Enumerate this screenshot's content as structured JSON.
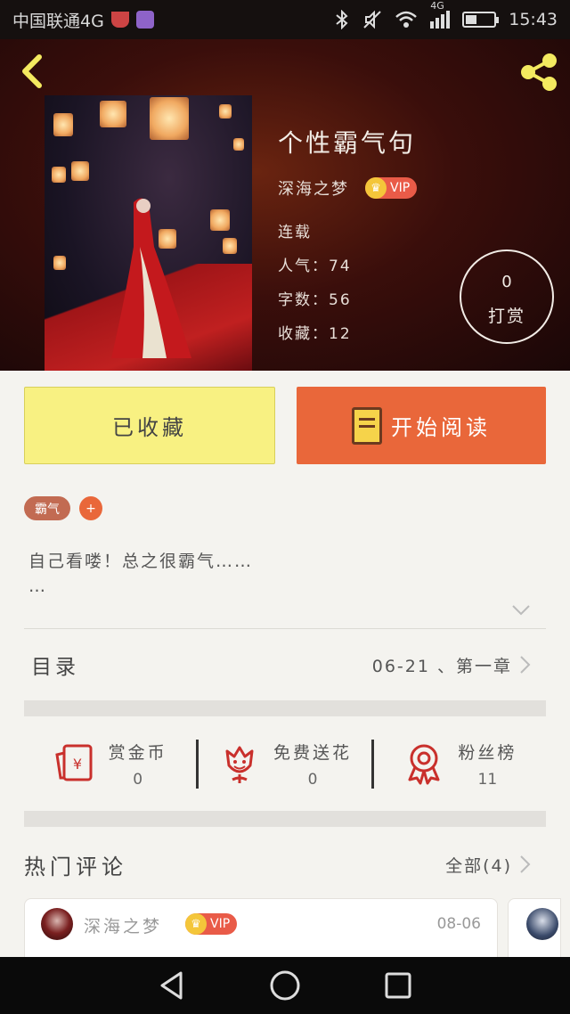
{
  "status_bar": {
    "carrier": "中国联通4G",
    "network": "4G",
    "time": "15:43"
  },
  "book": {
    "title": "个性霸气句",
    "author": "深海之梦",
    "vip_label": "VIP",
    "status": "连载",
    "popularity": "人气：74",
    "word_count": "字数：56",
    "favorites": "收藏：12",
    "reward_count": "0",
    "reward_label": "打赏"
  },
  "actions": {
    "collected_label": "已收藏",
    "read_label": "开始阅读"
  },
  "tags": {
    "items": [
      "霸气"
    ],
    "add_label": "+"
  },
  "description": {
    "line1": "自己看喽！总之很霸气……",
    "line2": "…"
  },
  "toc": {
    "label": "目录",
    "latest": "06-21 、第一章"
  },
  "stats": [
    {
      "label": "赏金币",
      "value": "0",
      "icon": "red-envelope-icon"
    },
    {
      "label": "免费送花",
      "value": "0",
      "icon": "flower-icon"
    },
    {
      "label": "粉丝榜",
      "value": "11",
      "icon": "ribbon-badge-icon"
    }
  ],
  "comments": {
    "title": "热门评论",
    "all_label": "全部(4)",
    "items": [
      {
        "user": "深海之梦",
        "vip": "VIP",
        "date": "08-06"
      }
    ]
  },
  "colors": {
    "accent_orange": "#e9673a",
    "collected_yellow": "#f8f182",
    "icon_red": "#c9302c",
    "vip_red": "#e95b48"
  }
}
